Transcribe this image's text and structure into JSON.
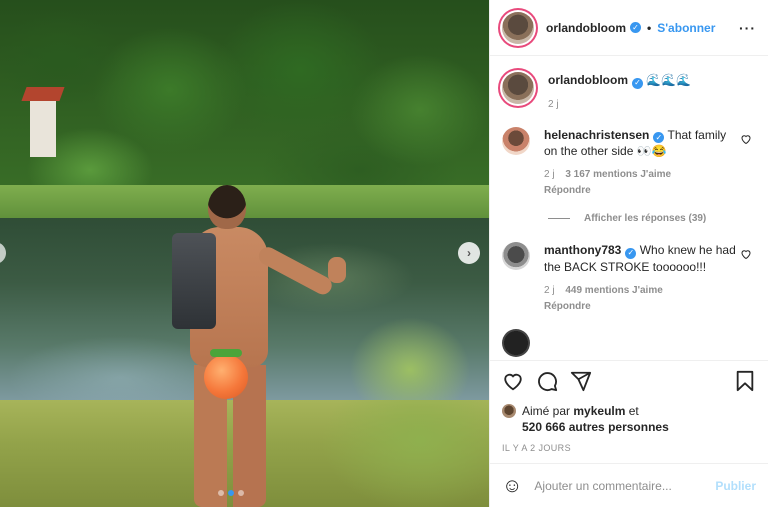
{
  "header": {
    "username": "orlandobloom",
    "separator": "•",
    "follow_label": "S'abonner",
    "more_label": "···"
  },
  "caption": {
    "username": "orlandobloom",
    "text": "🌊🌊🌊",
    "time": "2 j"
  },
  "comments": [
    {
      "username": "helenachristensen",
      "text": "That family on the other side 👀😂",
      "time": "2 j",
      "likes": "3 167 mentions J'aime",
      "reply": "Répondre"
    },
    {
      "username": "manthony783",
      "text": "Who knew he had the BACK STROKE toooooo!!!",
      "time": "2 j",
      "likes": "449 mentions J'aime",
      "reply": "Répondre"
    }
  ],
  "view_replies": "Afficher les réponses (39)",
  "likes": {
    "prefix": "Aimé par",
    "user": "mykeulm",
    "suffix": "et",
    "others": "520 666 autres personnes"
  },
  "date": "IL Y A 2 JOURS",
  "add_comment": {
    "placeholder": "Ajouter un commentaire...",
    "publish_label": "Publier"
  },
  "icons": {
    "emoji": "☺",
    "next": "›"
  },
  "colors": {
    "accent": "#3897f0",
    "publish_disabled": "#b2dffc",
    "muted": "#8e8e8e",
    "text": "#262626"
  }
}
